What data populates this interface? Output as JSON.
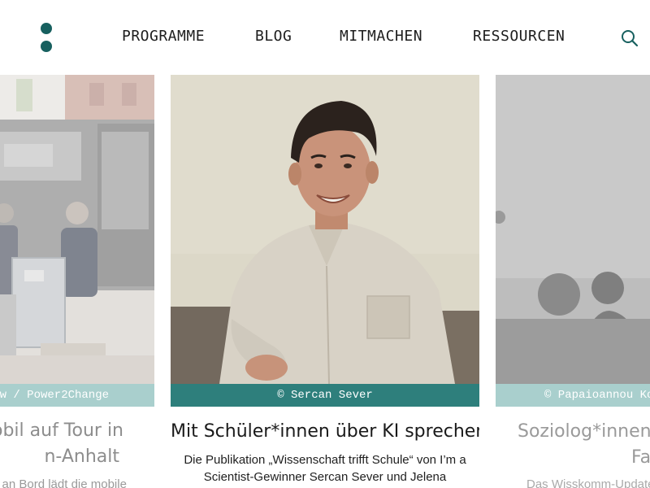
{
  "nav": {
    "items": [
      {
        "label": "PROGRAMME"
      },
      {
        "label": "BLOG"
      },
      {
        "label": "MITMACHEN"
      },
      {
        "label": "RESSOURCEN"
      }
    ]
  },
  "colors": {
    "brand": "#17605f",
    "credit_active": "#2e7f7c",
    "credit_faded": "#a9cfcd"
  },
  "cards": [
    {
      "credit": "w / Power2Change",
      "title_line1": "obil auf Tour in",
      "title_line2": "n-Anhalt",
      "description": "n an Bord lädt die mobile"
    },
    {
      "credit": "© Sercan Sever",
      "title": "Mit Schüler*innen über KI sprechen",
      "description": "Die Publikation „Wissenschaft trifft Schule“ von I’m a Scientist-Gewinner Sercan Sever und Jelena"
    },
    {
      "credit": "© Papaioannou Ko",
      "title_line1": "Soziolog*innen s",
      "title_line2": "Fa",
      "description": "Das Wisskomm-Update"
    }
  ]
}
